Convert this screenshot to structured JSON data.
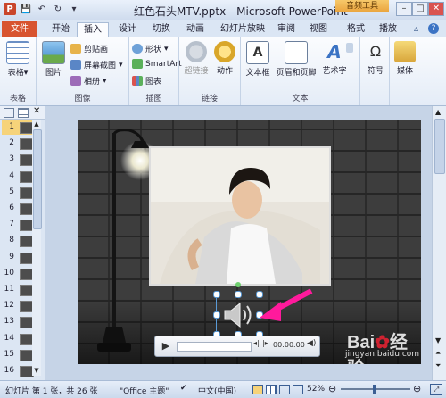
{
  "titlebar": {
    "title": "红色石头MTV.pptx - Microsoft PowerPoint",
    "context_tab": "音频工具",
    "quick_access": [
      "save-icon",
      "undo-icon",
      "redo-icon",
      "customize-icon"
    ]
  },
  "tabs": [
    {
      "label": "文件"
    },
    {
      "label": "开始"
    },
    {
      "label": "插入"
    },
    {
      "label": "设计"
    },
    {
      "label": "切换"
    },
    {
      "label": "动画"
    },
    {
      "label": "幻灯片放映"
    },
    {
      "label": "审阅"
    },
    {
      "label": "视图"
    },
    {
      "label": "格式"
    },
    {
      "label": "播放"
    }
  ],
  "ribbon": {
    "table": {
      "btn": "表格",
      "group": "表格"
    },
    "image": {
      "picture": "图片",
      "clipart": "剪贴画",
      "screenshot": "屏幕截图",
      "album": "相册",
      "group": "图像"
    },
    "illus": {
      "shapes": "形状",
      "smartart": "SmartArt",
      "chart": "图表",
      "group": "插图"
    },
    "links": {
      "hyperlink": "超链接",
      "action": "动作",
      "group": "链接"
    },
    "text": {
      "textbox": "文本框",
      "header": "页眉和页脚",
      "wordart": "艺术字",
      "group": "文本"
    },
    "symbol": {
      "btn": "符号"
    },
    "media": {
      "btn": "媒体"
    }
  },
  "slides_panel": {
    "numbers": [
      "1",
      "2",
      "3",
      "4",
      "5",
      "6",
      "7",
      "8",
      "9",
      "10",
      "11",
      "12",
      "13",
      "14",
      "15",
      "16"
    ]
  },
  "player": {
    "time": "00:00.00"
  },
  "status": {
    "slide_info": "幻灯片 第 1 张，共 26 张",
    "theme": "\"Office 主题\"",
    "language": "中文(中国)",
    "zoom": "52%"
  },
  "watermark": {
    "site": "jingyan.baidu.com"
  },
  "colors": {
    "file_tab": "#d8542f",
    "context_tab": "#eaa33c",
    "arrow": "#ff1a9c"
  }
}
